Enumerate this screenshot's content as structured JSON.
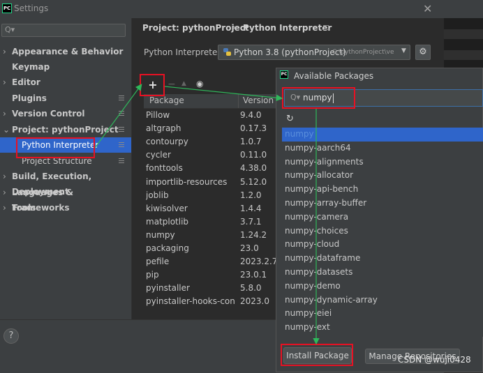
{
  "window": {
    "title": "Settings",
    "logo_text": "PC",
    "close_glyph": "✕"
  },
  "sidebar": {
    "search_glyph": "Q▾",
    "items": [
      {
        "label": "Appearance & Behavior",
        "chevron": "›",
        "badge": false
      },
      {
        "label": "Keymap",
        "chevron": "",
        "badge": false
      },
      {
        "label": "Editor",
        "chevron": "›",
        "badge": false
      },
      {
        "label": "Plugins",
        "chevron": "",
        "badge": true
      },
      {
        "label": "Version Control",
        "chevron": "›",
        "badge": true
      },
      {
        "label": "Project: pythonProject",
        "chevron": "⌄",
        "badge": true
      },
      {
        "label": "Python Interpreter",
        "chevron": "",
        "badge": true,
        "selected": true
      },
      {
        "label": "Project Structure",
        "chevron": "",
        "badge": true
      },
      {
        "label": "Build, Execution, Deployment",
        "chevron": "›",
        "badge": false
      },
      {
        "label": "Languages & Frameworks",
        "chevron": "›",
        "badge": false
      },
      {
        "label": "Tools",
        "chevron": "›",
        "badge": false
      }
    ],
    "help_glyph": "?"
  },
  "breadcrumb": {
    "project": "Project: pythonProject",
    "separator": "›",
    "page": "Python Interpreter"
  },
  "interpreter": {
    "label": "Python Interpreter:",
    "value": "Python 3.8 (pythonProject)",
    "path": "C:\\pythonProject\\ve",
    "caret": "▼",
    "gear_glyph": "⚙"
  },
  "toolbar": {
    "add": "+",
    "remove": "−",
    "upgrade": "▲",
    "show": "◉"
  },
  "packages_table": {
    "headers": {
      "package": "Package",
      "version": "Version"
    },
    "rows": [
      {
        "name": "Pillow",
        "version": "9.4.0"
      },
      {
        "name": "altgraph",
        "version": "0.17.3"
      },
      {
        "name": "contourpy",
        "version": "1.0.7"
      },
      {
        "name": "cycler",
        "version": "0.11.0"
      },
      {
        "name": "fonttools",
        "version": "4.38.0"
      },
      {
        "name": "importlib-resources",
        "version": "5.12.0"
      },
      {
        "name": "joblib",
        "version": "1.2.0"
      },
      {
        "name": "kiwisolver",
        "version": "1.4.4"
      },
      {
        "name": "matplotlib",
        "version": "3.7.1"
      },
      {
        "name": "numpy",
        "version": "1.24.2"
      },
      {
        "name": "packaging",
        "version": "23.0"
      },
      {
        "name": "pefile",
        "version": "2023.2.7"
      },
      {
        "name": "pip",
        "version": "23.0.1"
      },
      {
        "name": "pyinstaller",
        "version": "5.8.0"
      },
      {
        "name": "pyinstaller-hooks-cont...",
        "version": "2023.0"
      }
    ]
  },
  "available_packages": {
    "title": "Available Packages",
    "logo_text": "PC",
    "search_glyph": "Q▾",
    "search_value": "numpy",
    "refresh_glyph": "↻",
    "items": [
      "numpy",
      "numpy-aarch64",
      "numpy-alignments",
      "numpy-allocator",
      "numpy-api-bench",
      "numpy-array-buffer",
      "numpy-camera",
      "numpy-choices",
      "numpy-cloud",
      "numpy-dataframe",
      "numpy-datasets",
      "numpy-demo",
      "numpy-dynamic-array",
      "numpy-eiei",
      "numpy-ext"
    ],
    "selected_index": 0,
    "install_label": "Install Package",
    "manage_label": "Manage Repositories"
  },
  "watermark": "CSDN @wuji0428",
  "colors": {
    "accent": "#2f65ca",
    "annotation": "#e81123",
    "arrow": "#2fb85b"
  }
}
